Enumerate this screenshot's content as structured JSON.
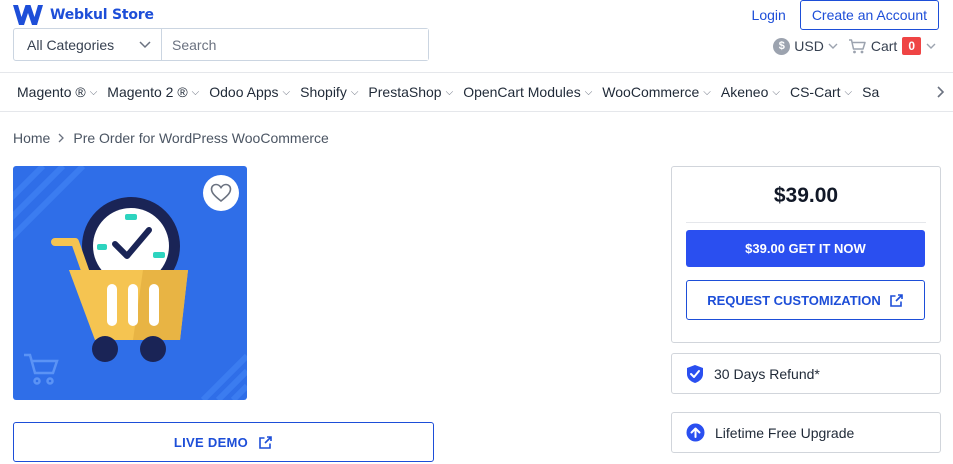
{
  "brand": {
    "name": "Webkul Store",
    "color": "#1d4ed8"
  },
  "header": {
    "login_label": "Login",
    "create_account_label": "Create an Account",
    "category_selected": "All Categories",
    "search_placeholder": "Search",
    "currency": "USD",
    "cart_label": "Cart",
    "cart_count": "0"
  },
  "nav": {
    "items": [
      {
        "label": "Magento ®"
      },
      {
        "label": "Magento 2 ®"
      },
      {
        "label": "Odoo Apps"
      },
      {
        "label": "Shopify"
      },
      {
        "label": "PrestaShop"
      },
      {
        "label": "OpenCart Modules"
      },
      {
        "label": "WooCommerce"
      },
      {
        "label": "Akeneo"
      },
      {
        "label": "CS-Cart"
      },
      {
        "label": "Sa"
      }
    ]
  },
  "breadcrumb": {
    "home": "Home",
    "current": "Pre Order for WordPress WooCommerce"
  },
  "product": {
    "image_bg": "#2f6ee8",
    "live_demo_label": "LIVE DEMO"
  },
  "purchase": {
    "price": "$39.00",
    "buy_label": "$39.00 GET IT NOW",
    "customize_label": "REQUEST CUSTOMIZATION",
    "accent": "#2a4ff0"
  },
  "perks": {
    "refund": "30 Days Refund*",
    "upgrade": "Lifetime Free Upgrade"
  }
}
